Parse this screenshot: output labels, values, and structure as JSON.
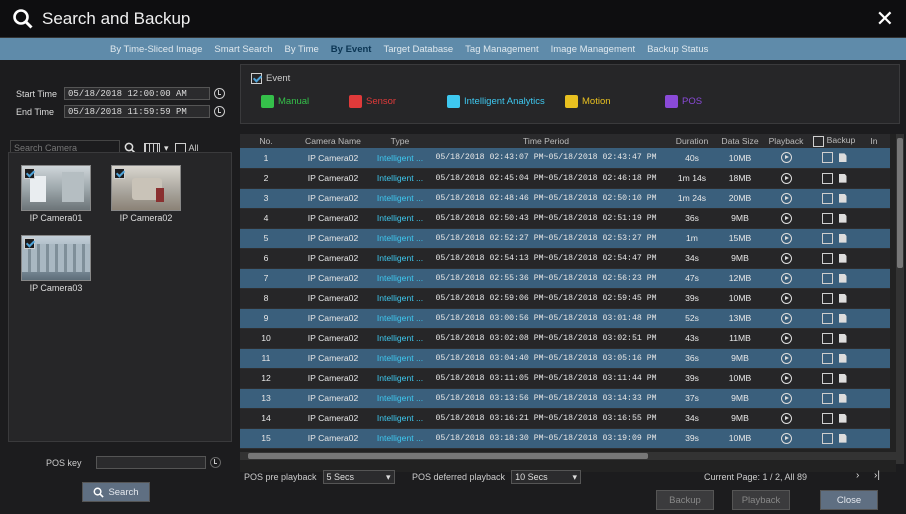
{
  "title": "Search and Backup",
  "tabs": [
    "By Time-Sliced Image",
    "Smart Search",
    "By Time",
    "By Event",
    "Target Database",
    "Tag Management",
    "Image Management",
    "Backup Status"
  ],
  "active_tab": 3,
  "start_time_label": "Start Time",
  "start_time": "05/18/2018 12:00:00 AM",
  "end_time_label": "End Time",
  "end_time": "05/18/2018 11:59:59 PM",
  "search_camera_placeholder": "Search Camera",
  "all_label": "All",
  "cameras": [
    {
      "name": "IP Camera01",
      "checked": true
    },
    {
      "name": "IP Camera02",
      "checked": true
    },
    {
      "name": "IP Camera03",
      "checked": true
    }
  ],
  "pos_key_label": "POS key",
  "search_button": "Search",
  "event": {
    "label": "Event",
    "checked": true
  },
  "event_types": [
    {
      "label": "Manual",
      "color": "#35c04a"
    },
    {
      "label": "Sensor",
      "color": "#e03a3a"
    },
    {
      "label": "Intelligent Analytics",
      "color": "#3ec8f0"
    },
    {
      "label": "Motion",
      "color": "#e8c020"
    },
    {
      "label": "POS",
      "color": "#8a4ad8"
    }
  ],
  "columns": [
    "No.",
    "Camera Name",
    "Type",
    "Time Period",
    "Duration",
    "Data Size",
    "Playback",
    "Backup",
    "In"
  ],
  "rows": [
    [
      "1",
      "IP Camera02",
      "Intelligent ...",
      "05/18/2018 02:43:07 PM~05/18/2018 02:43:47 PM",
      "40s",
      "10MB"
    ],
    [
      "2",
      "IP Camera02",
      "Intelligent ...",
      "05/18/2018 02:45:04 PM~05/18/2018 02:46:18 PM",
      "1m 14s",
      "18MB"
    ],
    [
      "3",
      "IP Camera02",
      "Intelligent ...",
      "05/18/2018 02:48:46 PM~05/18/2018 02:50:10 PM",
      "1m 24s",
      "20MB"
    ],
    [
      "4",
      "IP Camera02",
      "Intelligent ...",
      "05/18/2018 02:50:43 PM~05/18/2018 02:51:19 PM",
      "36s",
      "9MB"
    ],
    [
      "5",
      "IP Camera02",
      "Intelligent ...",
      "05/18/2018 02:52:27 PM~05/18/2018 02:53:27 PM",
      "1m",
      "15MB"
    ],
    [
      "6",
      "IP Camera02",
      "Intelligent ...",
      "05/18/2018 02:54:13 PM~05/18/2018 02:54:47 PM",
      "34s",
      "9MB"
    ],
    [
      "7",
      "IP Camera02",
      "Intelligent ...",
      "05/18/2018 02:55:36 PM~05/18/2018 02:56:23 PM",
      "47s",
      "12MB"
    ],
    [
      "8",
      "IP Camera02",
      "Intelligent ...",
      "05/18/2018 02:59:06 PM~05/18/2018 02:59:45 PM",
      "39s",
      "10MB"
    ],
    [
      "9",
      "IP Camera02",
      "Intelligent ...",
      "05/18/2018 03:00:56 PM~05/18/2018 03:01:48 PM",
      "52s",
      "13MB"
    ],
    [
      "10",
      "IP Camera02",
      "Intelligent ...",
      "05/18/2018 03:02:08 PM~05/18/2018 03:02:51 PM",
      "43s",
      "11MB"
    ],
    [
      "11",
      "IP Camera02",
      "Intelligent ...",
      "05/18/2018 03:04:40 PM~05/18/2018 03:05:16 PM",
      "36s",
      "9MB"
    ],
    [
      "12",
      "IP Camera02",
      "Intelligent ...",
      "05/18/2018 03:11:05 PM~05/18/2018 03:11:44 PM",
      "39s",
      "10MB"
    ],
    [
      "13",
      "IP Camera02",
      "Intelligent ...",
      "05/18/2018 03:13:56 PM~05/18/2018 03:14:33 PM",
      "37s",
      "9MB"
    ],
    [
      "14",
      "IP Camera02",
      "Intelligent ...",
      "05/18/2018 03:16:21 PM~05/18/2018 03:16:55 PM",
      "34s",
      "9MB"
    ],
    [
      "15",
      "IP Camera02",
      "Intelligent ...",
      "05/18/2018 03:18:30 PM~05/18/2018 03:19:09 PM",
      "39s",
      "10MB"
    ]
  ],
  "pos_pre_playback_label": "POS pre playback",
  "pos_pre_playback": "5 Secs",
  "pos_deferred_playback_label": "POS deferred playback",
  "pos_deferred_playback": "10 Secs",
  "pagination": "Current Page: 1 / 2, All 89",
  "buttons": {
    "backup": "Backup",
    "playback": "Playback",
    "close": "Close"
  }
}
